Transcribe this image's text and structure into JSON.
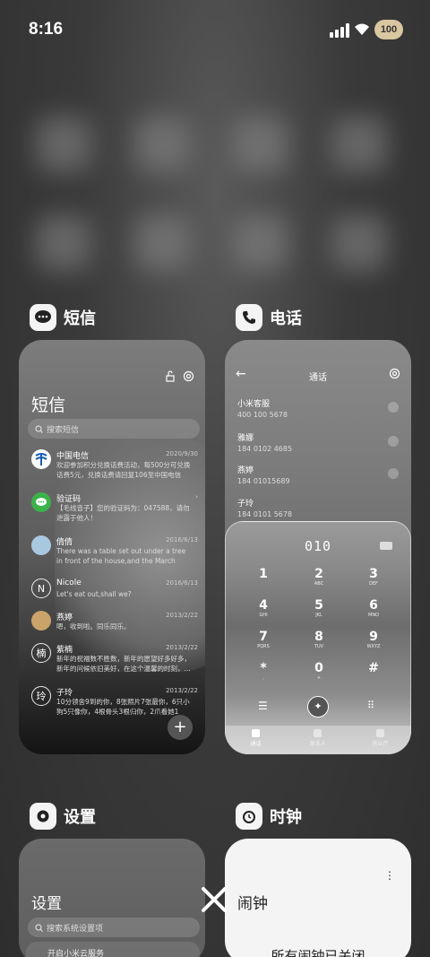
{
  "status": {
    "time": "8:16",
    "battery": "100"
  },
  "sms_app": {
    "name": "短信",
    "title": "短信",
    "search_placeholder": "搜索短信",
    "messages": [
      {
        "name": "中国电信",
        "date": "2020/9/30",
        "preview": "欢迎参加积分兑换话费活动，每500分可兑换话费5元，兑换话费请回复106至中国电信",
        "avatar": ""
      },
      {
        "name": "验证码",
        "date": "",
        "preview": "【毛线音子】您的验证码为：047588，请勿泄露于他人！",
        "avatar": ""
      },
      {
        "name": "倩倩",
        "date": "2016/6/13",
        "preview": "There was a table set out under a tree in front of the house,and the March Hare an...",
        "avatar": ""
      },
      {
        "name": "Nicole",
        "date": "2016/6/13",
        "preview": "Let's eat out,shall we?",
        "avatar": "N"
      },
      {
        "name": "燕婷",
        "date": "2013/2/22",
        "preview": "嗯，收到啦。同乐同乐。",
        "avatar": ""
      },
      {
        "name": "紫楠",
        "date": "2013/2/22",
        "preview": "新年的祝福数不胜数，新年的愿望好多好多，新年的问候依旧美好，在这个温馨的时刻，...",
        "avatar": "楠"
      },
      {
        "name": "子玲",
        "date": "2013/2/22",
        "preview": "10分领舍9到的你，8张照片7张最你，6只小狗5只像你，4根骨头3根归你，2爪看她1",
        "avatar": "玲"
      }
    ],
    "fab": "+"
  },
  "phone_app": {
    "name": "电话",
    "title": "通话",
    "contacts": [
      {
        "name": "小米客服",
        "number": "400 100 5678"
      },
      {
        "name": "雅娜",
        "number": "184 0102 4685"
      },
      {
        "name": "燕婷",
        "number": "184 01015689"
      },
      {
        "name": "子玲",
        "number": "184 0101 5678"
      }
    ],
    "dial_digits": "010",
    "keys": [
      {
        "n": "1",
        "l": ""
      },
      {
        "n": "2",
        "l": "ABC"
      },
      {
        "n": "3",
        "l": "DEF"
      },
      {
        "n": "4",
        "l": "GHI"
      },
      {
        "n": "5",
        "l": "JKL"
      },
      {
        "n": "6",
        "l": "MNO"
      },
      {
        "n": "7",
        "l": "PQRS"
      },
      {
        "n": "8",
        "l": "TUV"
      },
      {
        "n": "9",
        "l": "WXYZ"
      },
      {
        "n": "*",
        "l": ","
      },
      {
        "n": "0",
        "l": "+"
      },
      {
        "n": "#",
        "l": ""
      }
    ],
    "nav": [
      "通话",
      "联系人",
      "营业厅"
    ]
  },
  "settings_app": {
    "name": "设置",
    "title": "设置",
    "search_placeholder": "搜索系统设置项",
    "row": "开启小米云服务"
  },
  "clock_app": {
    "name": "时钟",
    "title": "闹钟",
    "empty": "所有闹钟已关闭"
  }
}
